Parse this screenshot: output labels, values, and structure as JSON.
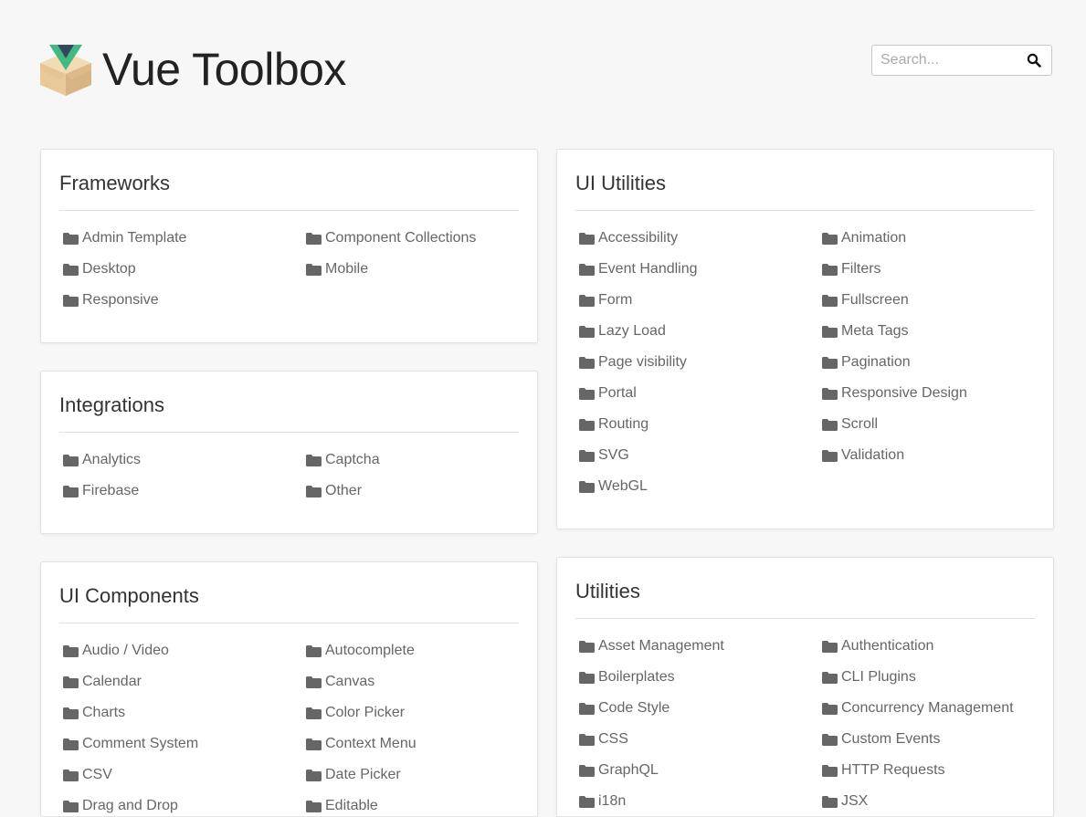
{
  "header": {
    "title": "Vue Toolbox"
  },
  "search": {
    "placeholder": "Search..."
  },
  "colors": {
    "folder": "#666666",
    "background": "#f7f7f7",
    "vue_green": "#42b883",
    "vue_dark": "#35495e",
    "box": "#e8c99a"
  },
  "icons": {
    "logo": "vue-box-logo",
    "search": "search-icon",
    "folder": "folder-icon"
  },
  "cards": {
    "frameworks": {
      "title": "Frameworks",
      "items": [
        "Admin Template",
        "Component Collections",
        "Desktop",
        "Mobile",
        "Responsive"
      ]
    },
    "integrations": {
      "title": "Integrations",
      "items": [
        "Analytics",
        "Captcha",
        "Firebase",
        "Other"
      ]
    },
    "ui_components": {
      "title": "UI Components",
      "items": [
        "Audio / Video",
        "Autocomplete",
        "Calendar",
        "Canvas",
        "Charts",
        "Color Picker",
        "Comment System",
        "Context Menu",
        "CSV",
        "Date Picker",
        "Drag and Drop",
        "Editable"
      ]
    },
    "ui_utilities": {
      "title": "UI Utilities",
      "items": [
        "Accessibility",
        "Animation",
        "Event Handling",
        "Filters",
        "Form",
        "Fullscreen",
        "Lazy Load",
        "Meta Tags",
        "Page visibility",
        "Pagination",
        "Portal",
        "Responsive Design",
        "Routing",
        "Scroll",
        "SVG",
        "Validation",
        "WebGL"
      ]
    },
    "utilities": {
      "title": "Utilities",
      "items": [
        "Asset Management",
        "Authentication",
        "Boilerplates",
        "CLI Plugins",
        "Code Style",
        "Concurrency Management",
        "CSS",
        "Custom Events",
        "GraphQL",
        "HTTP Requests",
        "i18n",
        "JSX"
      ]
    }
  }
}
